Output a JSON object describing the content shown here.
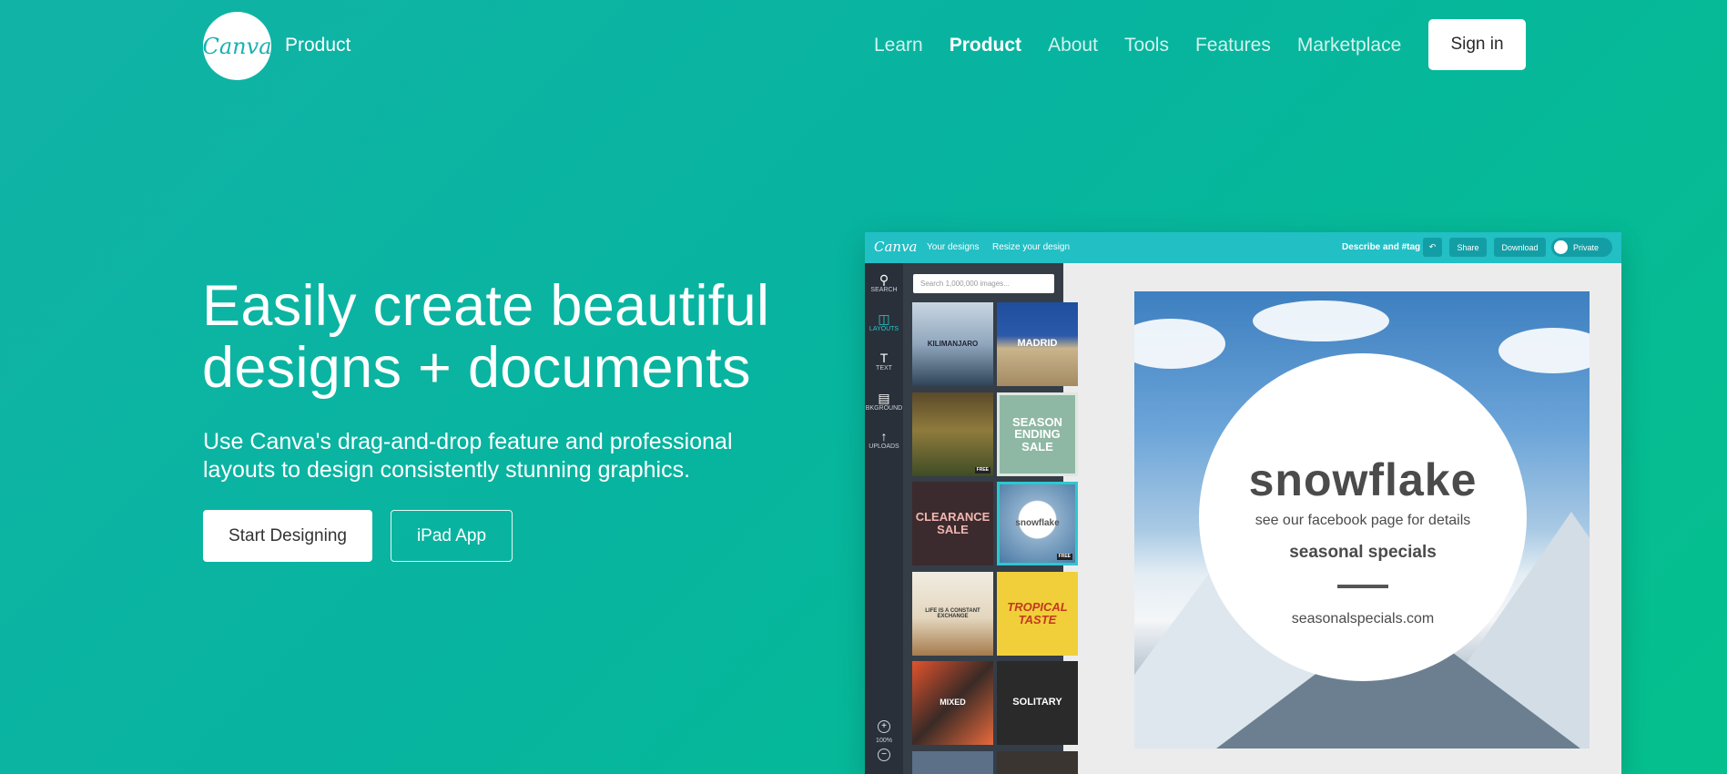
{
  "header": {
    "logo_text": "Canva",
    "section_title": "Product",
    "nav": [
      {
        "label": "Learn",
        "active": false
      },
      {
        "label": "Product",
        "active": true
      },
      {
        "label": "About",
        "active": false
      },
      {
        "label": "Tools",
        "active": false
      },
      {
        "label": "Features",
        "active": false
      },
      {
        "label": "Marketplace",
        "active": false
      }
    ],
    "signin_label": "Sign in"
  },
  "hero": {
    "title_line1": "Easily create beautiful",
    "title_line2": "designs + documents",
    "subtitle_line1": "Use Canva's drag-and-drop feature and professional",
    "subtitle_line2": "layouts to design consistently stunning graphics.",
    "primary_button": "Start Designing",
    "secondary_button": "iPad App"
  },
  "editor": {
    "logo_text": "Canva",
    "links": [
      "Your designs",
      "Resize your design"
    ],
    "tag_label": "Describe and #tag",
    "undo_icon": "undo-icon",
    "share_label": "Share",
    "download_label": "Download",
    "privacy_label": "Private",
    "rail": [
      {
        "label": "SEARCH",
        "icon": "search-icon"
      },
      {
        "label": "LAYOUTS",
        "icon": "layouts-icon",
        "active": true
      },
      {
        "label": "TEXT",
        "icon": "text-icon"
      },
      {
        "label": "BKGROUND",
        "icon": "background-icon"
      },
      {
        "label": "UPLOADS",
        "icon": "upload-icon"
      }
    ],
    "zoom_level": "100%",
    "search_placeholder": "Search 1,000,000 images...",
    "layouts": [
      {
        "title": "KILIMANJARO",
        "badge": ""
      },
      {
        "title": "MADRID",
        "badge": ""
      },
      {
        "title": "",
        "badge": "FREE"
      },
      {
        "title": "SEASON ENDING SALE",
        "badge": ""
      },
      {
        "title": "CLEARANCE SALE",
        "badge": ""
      },
      {
        "title": "snowflake",
        "badge": "FREE"
      },
      {
        "title": "LIFE IS A CONSTANT EXCHANGE",
        "badge": ""
      },
      {
        "title": "TROPICAL TASTE",
        "badge": ""
      },
      {
        "title": "MIXED",
        "badge": ""
      },
      {
        "title": "SOLITARY",
        "badge": ""
      }
    ],
    "canvas": {
      "title": "snowflake",
      "line1": "see our facebook page for details",
      "line2": "seasonal specials",
      "line3": "seasonalspecials.com"
    }
  }
}
